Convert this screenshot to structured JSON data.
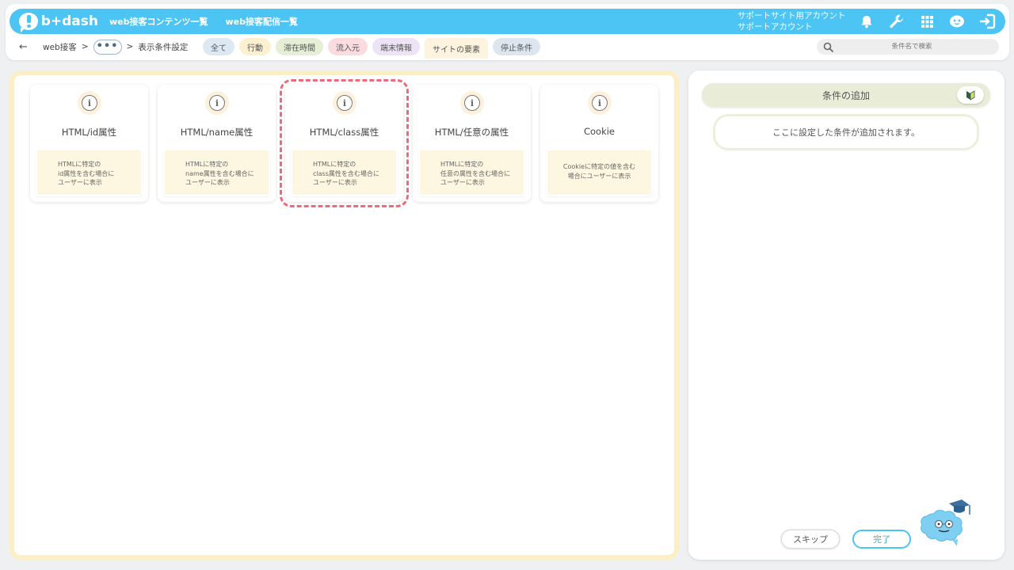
{
  "header": {
    "logo_text": "b+dash",
    "nav": [
      "web接客コンテンツ一覧",
      "web接客配信一覧"
    ],
    "account_line1": "サポートサイト用アカウント",
    "account_line2": "サポートアカウント"
  },
  "breadcrumb": {
    "back": "←",
    "root": "web接客",
    "sep": ">",
    "ellipsis": "•••",
    "current": "表示条件設定"
  },
  "filters": [
    {
      "label": "全て",
      "color": "#dce8f2"
    },
    {
      "label": "行動",
      "color": "#fbf0cf"
    },
    {
      "label": "滞在時間",
      "color": "#e6eed5"
    },
    {
      "label": "流入元",
      "color": "#fadbe0"
    },
    {
      "label": "端末情報",
      "color": "#ece4f6"
    },
    {
      "label": "サイトの要素",
      "color": "#fdf3df"
    },
    {
      "label": "停止条件",
      "color": "#dde6ef"
    }
  ],
  "search": {
    "placeholder": "条件名で検索"
  },
  "cards": [
    {
      "title": "HTML/id属性",
      "desc": "HTMLに特定の\nid属性を含む場合に\nユーザーに表示"
    },
    {
      "title": "HTML/name属性",
      "desc": "HTMLに特定の\nname属性を含む場合に\nユーザーに表示"
    },
    {
      "title": "HTML/class属性",
      "desc": "HTMLに特定の\nclass属性を含む場合に\nユーザーに表示"
    },
    {
      "title": "HTML/任意の属性",
      "desc": "HTMLに特定の\n任意の属性を含む場合に\nユーザーに表示"
    },
    {
      "title": "Cookie",
      "desc": "Cookieに特定の値を含む\n場合にユーザーに表示"
    }
  ],
  "right": {
    "add_title": "条件の追加",
    "placeholder": "ここに設定した条件が追加されます。",
    "skip": "スキップ",
    "done": "完了"
  },
  "colors": {
    "brand": "#4cc4f4",
    "selected_outline": "#ec6a7e",
    "panel_border": "#fcefc5"
  },
  "icons": [
    "bell-icon",
    "wrench-icon",
    "grid-icon",
    "support-icon",
    "logout-icon",
    "search-icon",
    "info-icon",
    "beginner-mark-icon",
    "mascot-icon"
  ]
}
